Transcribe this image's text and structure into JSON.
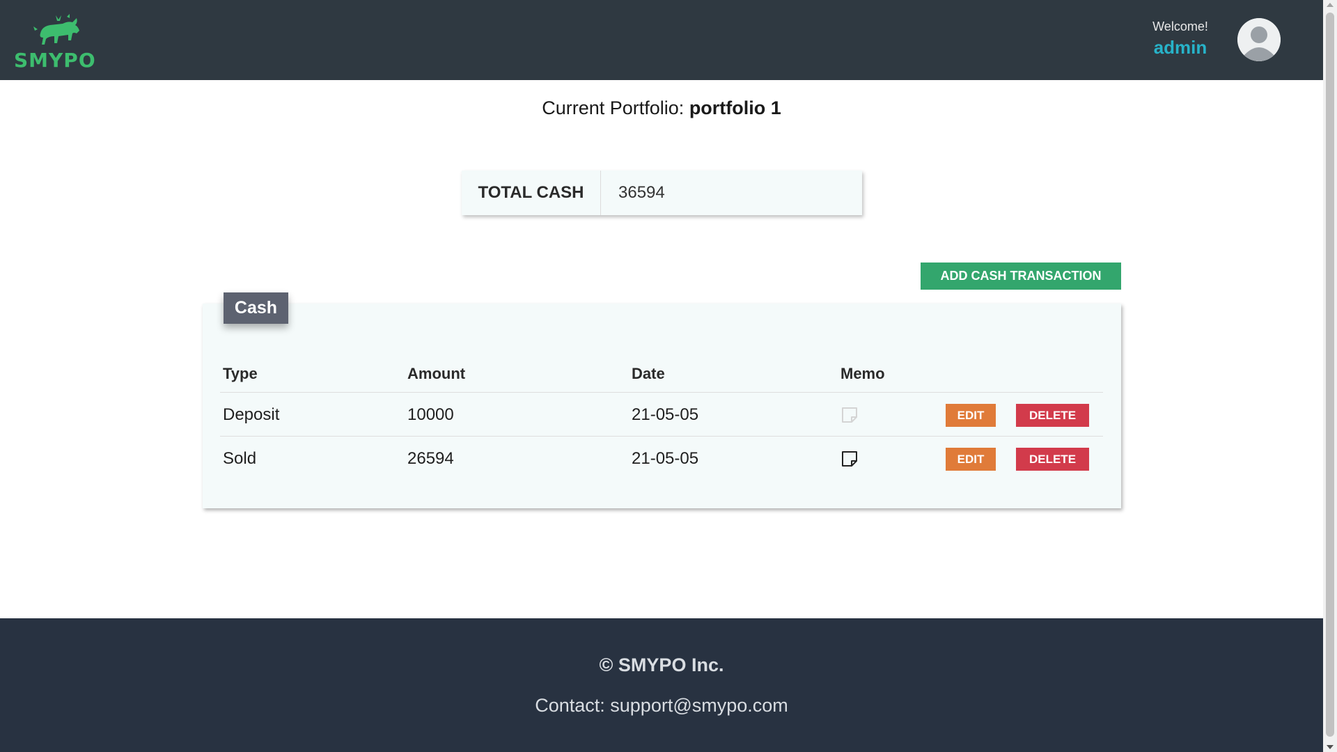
{
  "header": {
    "logo_text": "SMYPO",
    "welcome_text": "Welcome!",
    "username": "admin"
  },
  "portfolio": {
    "label": "Current Portfolio:",
    "name": "portfolio 1"
  },
  "total_cash": {
    "label": "TOTAL CASH",
    "value": "36594"
  },
  "actions": {
    "add_cash_label": "ADD CASH TRANSACTION"
  },
  "cash_section": {
    "title": "Cash",
    "columns": [
      "Type",
      "Amount",
      "Date",
      "Memo"
    ],
    "rows": [
      {
        "type": "Deposit",
        "amount": "10000",
        "date": "21-05-05",
        "memo_icon": "note-empty-icon",
        "edit_label": "EDIT",
        "delete_label": "DELETE"
      },
      {
        "type": "Sold",
        "amount": "26594",
        "date": "21-05-05",
        "memo_icon": "note-icon",
        "edit_label": "EDIT",
        "delete_label": "DELETE"
      }
    ]
  },
  "footer": {
    "copyright": "© SMYPO Inc.",
    "contact": "Contact: support@smypo.com"
  },
  "colors": {
    "header_bg": "#2f3941",
    "brand_green": "#3dbd6e",
    "username_accent": "#27b3c9",
    "add_button": "#33a66d",
    "edit_button": "#e07b39",
    "delete_button": "#d23b4b",
    "footer_bg": "#283241"
  }
}
